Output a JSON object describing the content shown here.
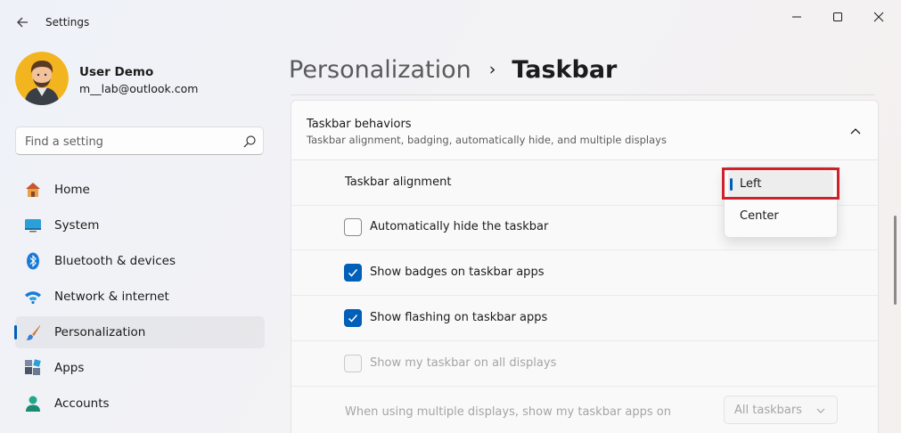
{
  "window": {
    "app_title": "Settings"
  },
  "profile": {
    "name": "User Demo",
    "email": "m__lab@outlook.com"
  },
  "search": {
    "placeholder": "Find a setting"
  },
  "nav": {
    "items": [
      {
        "label": "Home",
        "icon": "home-icon"
      },
      {
        "label": "System",
        "icon": "system-icon"
      },
      {
        "label": "Bluetooth & devices",
        "icon": "bluetooth-icon"
      },
      {
        "label": "Network & internet",
        "icon": "wifi-icon"
      },
      {
        "label": "Personalization",
        "icon": "brush-icon",
        "selected": true
      },
      {
        "label": "Apps",
        "icon": "apps-icon"
      },
      {
        "label": "Accounts",
        "icon": "accounts-icon"
      }
    ]
  },
  "header": {
    "parent": "Personalization",
    "separator": "›",
    "current": "Taskbar"
  },
  "section": {
    "title": "Taskbar behaviors",
    "subtitle": "Taskbar alignment, badging, automatically hide, and multiple displays",
    "alignment_label": "Taskbar alignment",
    "alignment_options": [
      "Left",
      "Center"
    ],
    "alignment_selected": "Left",
    "checkboxes": [
      {
        "label": "Automatically hide the taskbar",
        "checked": false,
        "disabled": false
      },
      {
        "label": "Show badges on taskbar apps",
        "checked": true,
        "disabled": false
      },
      {
        "label": "Show flashing on taskbar apps",
        "checked": true,
        "disabled": false
      },
      {
        "label": "Show my taskbar on all displays",
        "checked": false,
        "disabled": true
      }
    ],
    "multi_display_label": "When using multiple displays, show my taskbar apps on",
    "multi_display_value": "All taskbars"
  },
  "colors": {
    "accent": "#005fb8",
    "highlight": "#d0202c"
  }
}
